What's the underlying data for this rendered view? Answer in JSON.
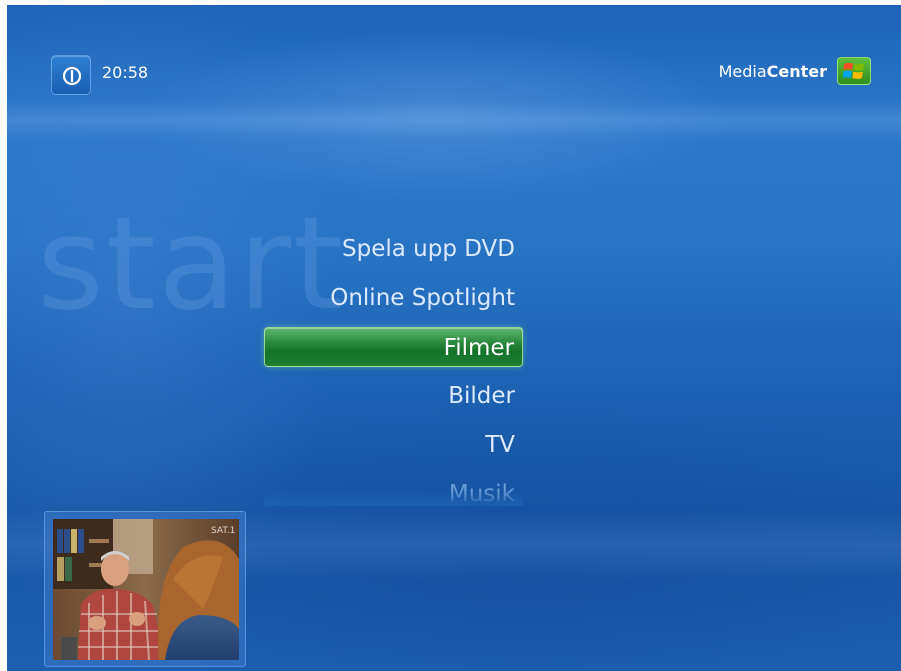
{
  "header": {
    "clock": "20:58",
    "logo_text_light": "Media",
    "logo_text_bold": "Center"
  },
  "page": {
    "watermark": "start"
  },
  "menu": {
    "items": [
      {
        "label": "Spela upp DVD",
        "state": "normal"
      },
      {
        "label": "Online Spotlight",
        "state": "normal"
      },
      {
        "label": "Filmer",
        "state": "selected"
      },
      {
        "label": "Bilder",
        "state": "normal"
      },
      {
        "label": "TV",
        "state": "normal"
      },
      {
        "label": "Musik",
        "state": "faded"
      }
    ]
  },
  "tv_inset": {
    "channel_logo": "SAT.1"
  },
  "colors": {
    "background": "#1f63b4",
    "selection": "#1f7e32",
    "menu_text": "#dceaff"
  },
  "icons": {
    "power": "power-icon",
    "logo": "windows-flag-icon"
  }
}
